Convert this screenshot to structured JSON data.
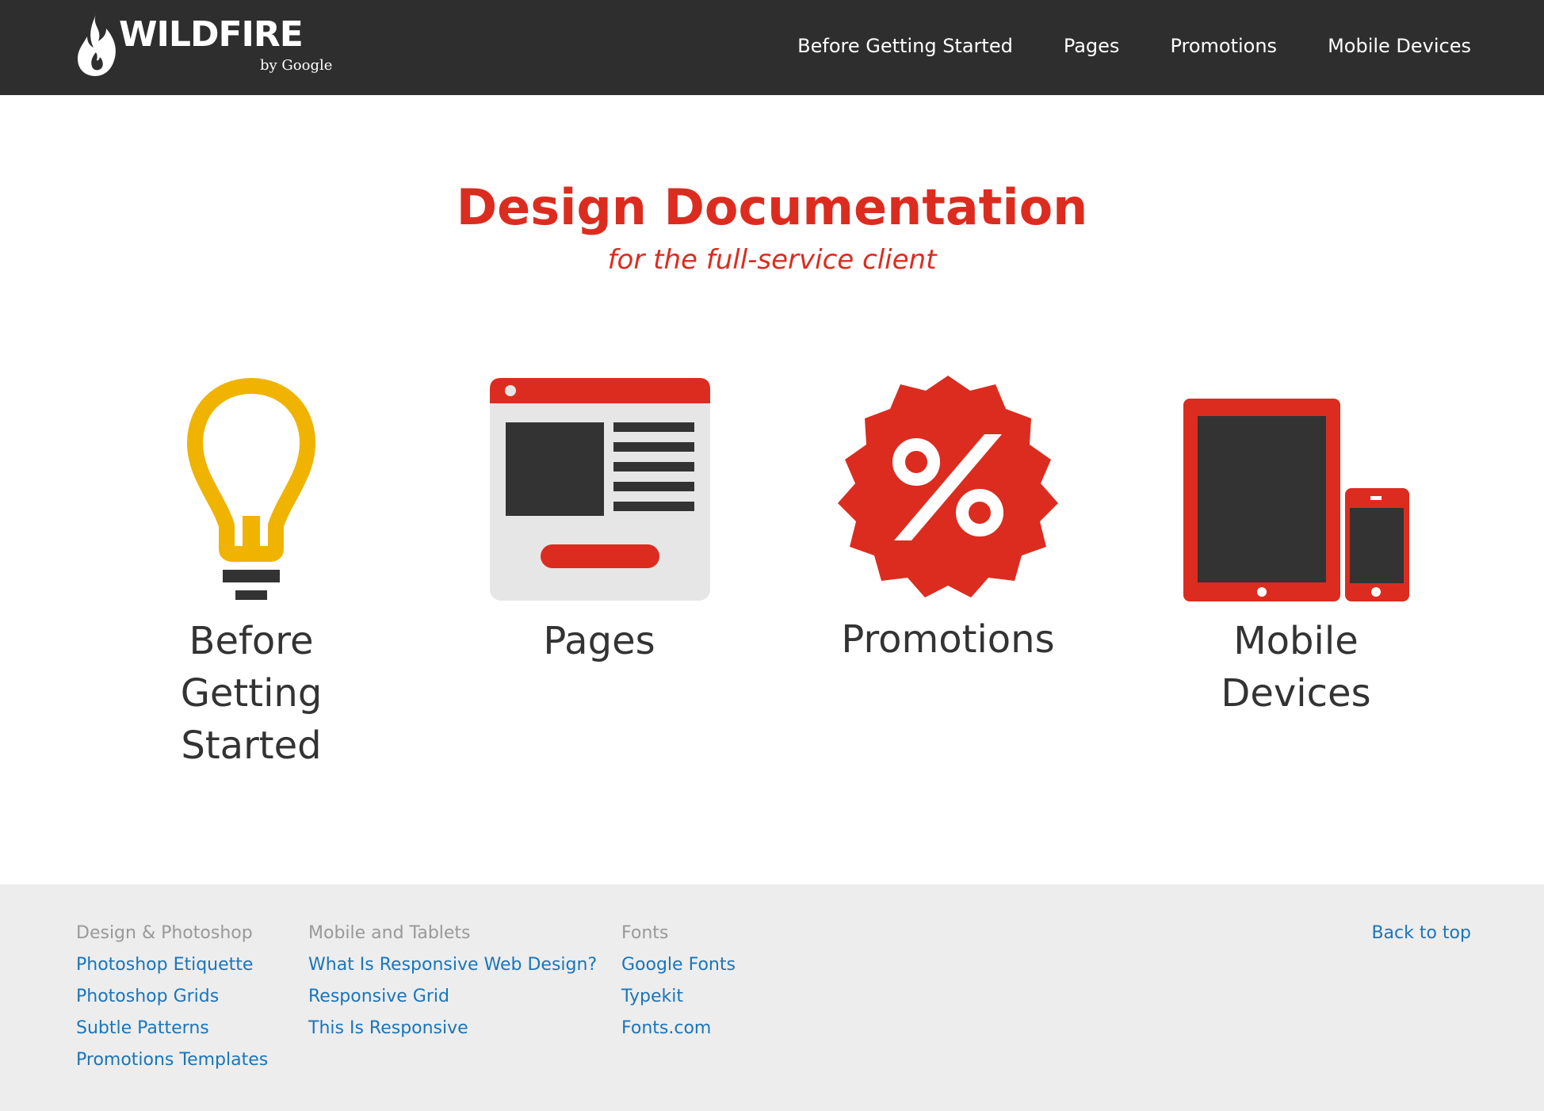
{
  "header": {
    "logo": {
      "wordmark": "WILDFIRE",
      "byline": "by Google"
    },
    "nav": [
      {
        "label": "Before Getting Started"
      },
      {
        "label": "Pages"
      },
      {
        "label": "Promotions"
      },
      {
        "label": "Mobile Devices"
      }
    ]
  },
  "hero": {
    "title": "Design Documentation",
    "subtitle": "for the full-service client"
  },
  "cards": [
    {
      "label": "Before Getting Started",
      "icon": "lightbulb-icon"
    },
    {
      "label": "Pages",
      "icon": "webpage-icon"
    },
    {
      "label": "Promotions",
      "icon": "percent-badge-icon"
    },
    {
      "label": "Mobile Devices",
      "icon": "tablet-phone-icon"
    }
  ],
  "colors": {
    "header_bg": "#2e2e2e",
    "brand_red": "#dc2c1f",
    "bulb_yellow": "#f0b300",
    "dark_gray": "#333333",
    "footer_bg": "#ededed",
    "link_blue": "#1a75bb"
  },
  "footer": {
    "columns": [
      {
        "heading": "Design & Photoshop",
        "links": [
          "Photoshop Etiquette",
          "Photoshop Grids",
          "Subtle Patterns",
          "Promotions Templates"
        ]
      },
      {
        "heading": "Mobile and Tablets",
        "links": [
          "What Is Responsive Web Design?",
          "Responsive Grid",
          "This Is Responsive"
        ]
      },
      {
        "heading": "Fonts",
        "links": [
          "Google Fonts",
          "Typekit",
          "Fonts.com"
        ]
      }
    ],
    "back_to_top": "Back to top"
  }
}
